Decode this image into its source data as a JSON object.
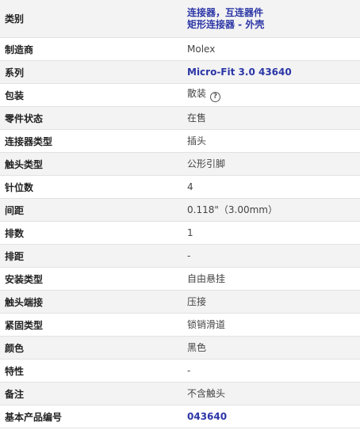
{
  "rows": [
    {
      "label": "类别",
      "links": [
        "连接器，互连器件",
        "矩形连接器 - 外壳"
      ]
    },
    {
      "label": "制造商",
      "value": "Molex"
    },
    {
      "label": "系列",
      "link": "Micro-Fit 3.0 43640"
    },
    {
      "label": "包装",
      "value": "散装"
    },
    {
      "label": "零件状态",
      "value": "在售"
    },
    {
      "label": "连接器类型",
      "value": "插头"
    },
    {
      "label": "触头类型",
      "value": "公形引脚"
    },
    {
      "label": "针位数",
      "value": "4"
    },
    {
      "label": "间距",
      "value": "0.118\"（3.00mm）"
    },
    {
      "label": "排数",
      "value": "1"
    },
    {
      "label": "排距",
      "value": "-"
    },
    {
      "label": "安装类型",
      "value": "自由悬挂"
    },
    {
      "label": "触头端接",
      "value": "压接"
    },
    {
      "label": "紧固类型",
      "value": "锁销滑道"
    },
    {
      "label": "颜色",
      "value": "黑色"
    },
    {
      "label": "特性",
      "value": "-"
    },
    {
      "label": "备注",
      "value": "不含触头"
    },
    {
      "label": "基本产品编号",
      "link": "043640"
    }
  ],
  "help_icon": {
    "glyph": "?",
    "name": "help-icon"
  },
  "colors": {
    "link": "#2b36a6",
    "stripe": "#f3f3f3"
  }
}
